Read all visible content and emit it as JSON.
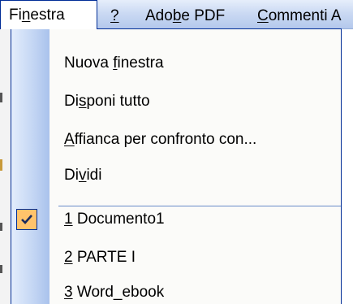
{
  "menubar": {
    "items": [
      {
        "pre": "Fi",
        "accel": "n",
        "post": "estra"
      },
      {
        "pre": "",
        "accel": "?",
        "post": ""
      },
      {
        "pre": "Ado",
        "accel": "b",
        "post": "e PDF"
      },
      {
        "pre": "",
        "accel": "C",
        "post": "ommenti A"
      }
    ]
  },
  "menu": {
    "items": [
      {
        "pre": "Nuova ",
        "accel": "f",
        "post": "inestra"
      },
      {
        "pre": "Di",
        "accel": "s",
        "post": "poni tutto"
      },
      {
        "pre": "",
        "accel": "A",
        "post": "ffianca per confronto con..."
      },
      {
        "pre": "Di",
        "accel": "v",
        "post": "idi"
      },
      {
        "pre": "",
        "accel": "1",
        "post": " Documento1"
      },
      {
        "pre": "",
        "accel": "2",
        "post": " PARTE  I"
      },
      {
        "pre": "",
        "accel": "3",
        "post": " Word_ebook"
      }
    ],
    "checked_item": "1 Documento1"
  },
  "colors": {
    "menu_border": "#002d96",
    "check_highlight": "#ffc36b",
    "gutter": "#c5d7f4"
  }
}
